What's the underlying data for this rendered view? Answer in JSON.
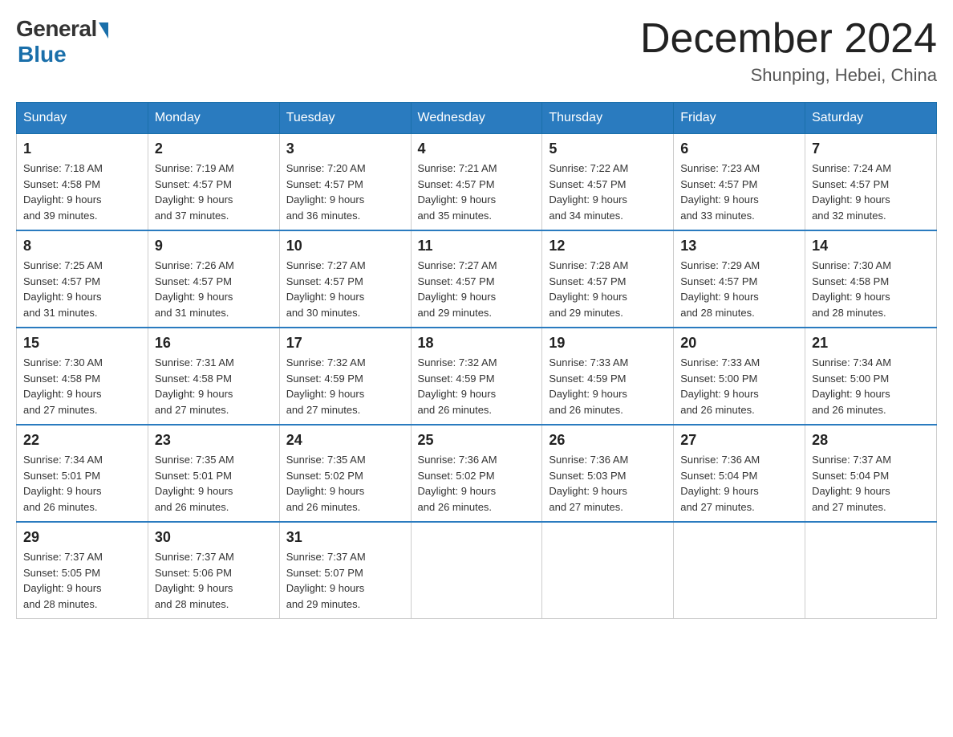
{
  "logo": {
    "general": "General",
    "blue": "Blue"
  },
  "header": {
    "month_year": "December 2024",
    "location": "Shunping, Hebei, China"
  },
  "weekdays": [
    "Sunday",
    "Monday",
    "Tuesday",
    "Wednesday",
    "Thursday",
    "Friday",
    "Saturday"
  ],
  "weeks": [
    [
      {
        "day": "1",
        "sunrise": "7:18 AM",
        "sunset": "4:58 PM",
        "daylight": "9 hours and 39 minutes."
      },
      {
        "day": "2",
        "sunrise": "7:19 AM",
        "sunset": "4:57 PM",
        "daylight": "9 hours and 37 minutes."
      },
      {
        "day": "3",
        "sunrise": "7:20 AM",
        "sunset": "4:57 PM",
        "daylight": "9 hours and 36 minutes."
      },
      {
        "day": "4",
        "sunrise": "7:21 AM",
        "sunset": "4:57 PM",
        "daylight": "9 hours and 35 minutes."
      },
      {
        "day": "5",
        "sunrise": "7:22 AM",
        "sunset": "4:57 PM",
        "daylight": "9 hours and 34 minutes."
      },
      {
        "day": "6",
        "sunrise": "7:23 AM",
        "sunset": "4:57 PM",
        "daylight": "9 hours and 33 minutes."
      },
      {
        "day": "7",
        "sunrise": "7:24 AM",
        "sunset": "4:57 PM",
        "daylight": "9 hours and 32 minutes."
      }
    ],
    [
      {
        "day": "8",
        "sunrise": "7:25 AM",
        "sunset": "4:57 PM",
        "daylight": "9 hours and 31 minutes."
      },
      {
        "day": "9",
        "sunrise": "7:26 AM",
        "sunset": "4:57 PM",
        "daylight": "9 hours and 31 minutes."
      },
      {
        "day": "10",
        "sunrise": "7:27 AM",
        "sunset": "4:57 PM",
        "daylight": "9 hours and 30 minutes."
      },
      {
        "day": "11",
        "sunrise": "7:27 AM",
        "sunset": "4:57 PM",
        "daylight": "9 hours and 29 minutes."
      },
      {
        "day": "12",
        "sunrise": "7:28 AM",
        "sunset": "4:57 PM",
        "daylight": "9 hours and 29 minutes."
      },
      {
        "day": "13",
        "sunrise": "7:29 AM",
        "sunset": "4:57 PM",
        "daylight": "9 hours and 28 minutes."
      },
      {
        "day": "14",
        "sunrise": "7:30 AM",
        "sunset": "4:58 PM",
        "daylight": "9 hours and 28 minutes."
      }
    ],
    [
      {
        "day": "15",
        "sunrise": "7:30 AM",
        "sunset": "4:58 PM",
        "daylight": "9 hours and 27 minutes."
      },
      {
        "day": "16",
        "sunrise": "7:31 AM",
        "sunset": "4:58 PM",
        "daylight": "9 hours and 27 minutes."
      },
      {
        "day": "17",
        "sunrise": "7:32 AM",
        "sunset": "4:59 PM",
        "daylight": "9 hours and 27 minutes."
      },
      {
        "day": "18",
        "sunrise": "7:32 AM",
        "sunset": "4:59 PM",
        "daylight": "9 hours and 26 minutes."
      },
      {
        "day": "19",
        "sunrise": "7:33 AM",
        "sunset": "4:59 PM",
        "daylight": "9 hours and 26 minutes."
      },
      {
        "day": "20",
        "sunrise": "7:33 AM",
        "sunset": "5:00 PM",
        "daylight": "9 hours and 26 minutes."
      },
      {
        "day": "21",
        "sunrise": "7:34 AM",
        "sunset": "5:00 PM",
        "daylight": "9 hours and 26 minutes."
      }
    ],
    [
      {
        "day": "22",
        "sunrise": "7:34 AM",
        "sunset": "5:01 PM",
        "daylight": "9 hours and 26 minutes."
      },
      {
        "day": "23",
        "sunrise": "7:35 AM",
        "sunset": "5:01 PM",
        "daylight": "9 hours and 26 minutes."
      },
      {
        "day": "24",
        "sunrise": "7:35 AM",
        "sunset": "5:02 PM",
        "daylight": "9 hours and 26 minutes."
      },
      {
        "day": "25",
        "sunrise": "7:36 AM",
        "sunset": "5:02 PM",
        "daylight": "9 hours and 26 minutes."
      },
      {
        "day": "26",
        "sunrise": "7:36 AM",
        "sunset": "5:03 PM",
        "daylight": "9 hours and 27 minutes."
      },
      {
        "day": "27",
        "sunrise": "7:36 AM",
        "sunset": "5:04 PM",
        "daylight": "9 hours and 27 minutes."
      },
      {
        "day": "28",
        "sunrise": "7:37 AM",
        "sunset": "5:04 PM",
        "daylight": "9 hours and 27 minutes."
      }
    ],
    [
      {
        "day": "29",
        "sunrise": "7:37 AM",
        "sunset": "5:05 PM",
        "daylight": "9 hours and 28 minutes."
      },
      {
        "day": "30",
        "sunrise": "7:37 AM",
        "sunset": "5:06 PM",
        "daylight": "9 hours and 28 minutes."
      },
      {
        "day": "31",
        "sunrise": "7:37 AM",
        "sunset": "5:07 PM",
        "daylight": "9 hours and 29 minutes."
      },
      null,
      null,
      null,
      null
    ]
  ],
  "labels": {
    "sunrise": "Sunrise:",
    "sunset": "Sunset:",
    "daylight": "Daylight:"
  }
}
